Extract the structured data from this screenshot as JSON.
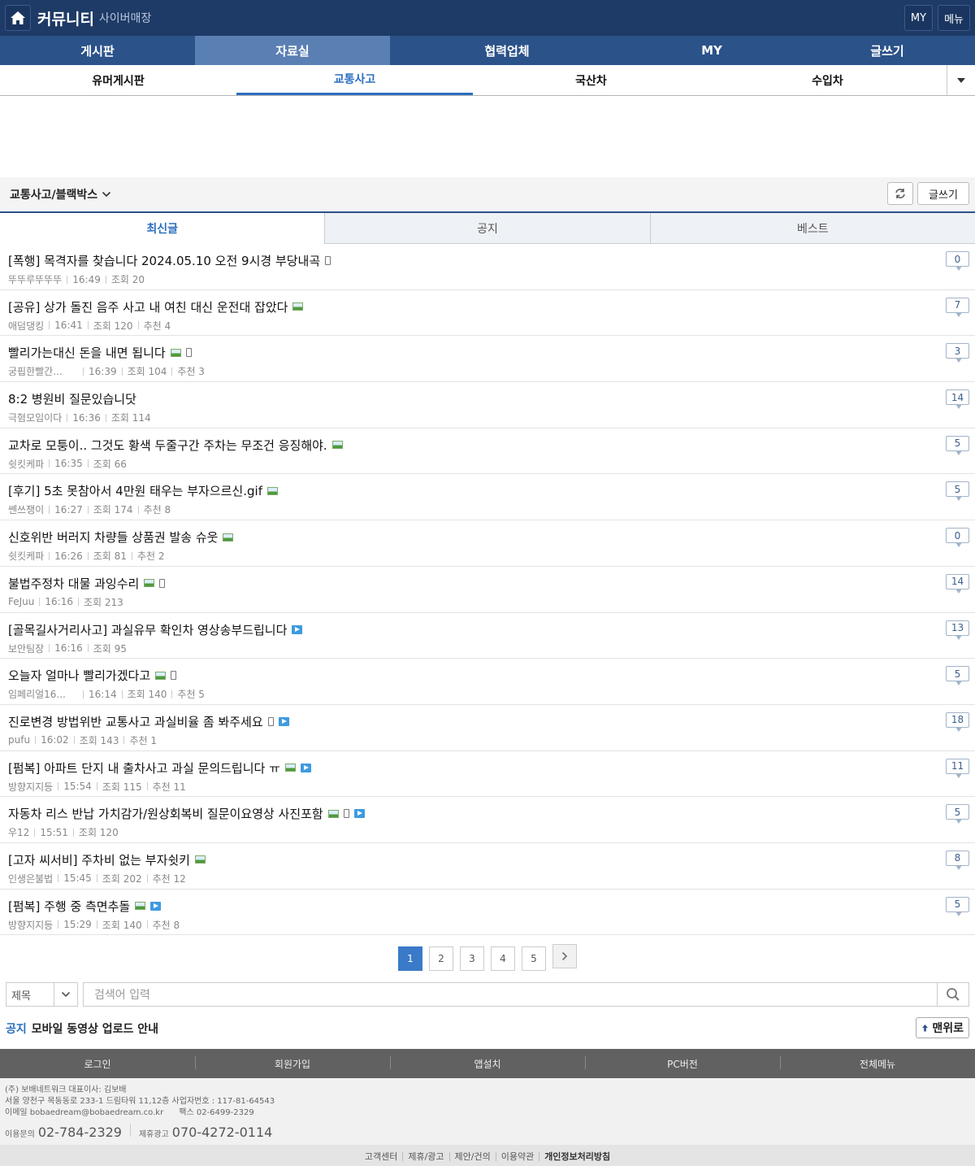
{
  "header": {
    "brand": "커뮤니티",
    "brand_sub": "사이버매장",
    "my_label": "MY",
    "menu_label": "메뉴"
  },
  "main_nav": [
    {
      "label": "게시판",
      "active": false
    },
    {
      "label": "자료실",
      "active": true
    },
    {
      "label": "협력업체",
      "active": false
    },
    {
      "label": "MY",
      "active": false
    },
    {
      "label": "글쓰기",
      "active": false
    }
  ],
  "sub_nav": [
    {
      "label": "유머게시판",
      "active": false
    },
    {
      "label": "교통사고",
      "active": true
    },
    {
      "label": "국산차",
      "active": false
    },
    {
      "label": "수입차",
      "active": false
    }
  ],
  "board": {
    "title": "교통사고/블랙박스",
    "write_label": "글쓰기"
  },
  "tabs": [
    {
      "label": "최신글",
      "active": true
    },
    {
      "label": "공지",
      "active": false
    },
    {
      "label": "베스트",
      "active": false
    }
  ],
  "posts": [
    {
      "title": "[폭행] 목격자를 찾습니다 2024.05.10 오전 9시경 부당내곡",
      "icons": [
        "mobile"
      ],
      "author": "뚜뚜루뚜뚜뚜",
      "time": "16:49",
      "views": "조회 20",
      "likes": "",
      "comments": "0"
    },
    {
      "title": "[공유] 상가 돌진 음주 사고 내 여친 대신 운전대 잡았다",
      "icons": [
        "image"
      ],
      "author": "애덤댕킹",
      "time": "16:41",
      "views": "조회 120",
      "likes": "추천 4",
      "comments": "7"
    },
    {
      "title": "빨리가는대신 돈을 내면 됩니다",
      "icons": [
        "image",
        "mobile"
      ],
      "author": "궁핍한빨간...",
      "time": "16:39",
      "views": "조회 104",
      "likes": "추천 3",
      "comments": "3"
    },
    {
      "title": "8:2 병원비 질문있습니닷",
      "icons": [],
      "author": "극혐모임이다",
      "time": "16:36",
      "views": "조회 114",
      "likes": "",
      "comments": "14"
    },
    {
      "title": "교차로 모퉁이.. 그것도 황색 두줄구간 주차는 무조건 응징해야.",
      "icons": [
        "image"
      ],
      "author": "쉿킷케파",
      "time": "16:35",
      "views": "조회 66",
      "likes": "",
      "comments": "5"
    },
    {
      "title": "[후기] 5초 못참아서 4만원 태우는 부자으르신.gif",
      "icons": [
        "image"
      ],
      "author": "쎈쓰쟁이",
      "time": "16:27",
      "views": "조회 174",
      "likes": "추천 8",
      "comments": "5"
    },
    {
      "title": "신호위반 버러지 차량들 상품권 발송 슈웃",
      "icons": [
        "image"
      ],
      "author": "쉿킷케파",
      "time": "16:26",
      "views": "조회 81",
      "likes": "추천 2",
      "comments": "0"
    },
    {
      "title": "불법주정차 대물 과잉수리",
      "icons": [
        "image",
        "mobile"
      ],
      "author": "FeJuu",
      "time": "16:16",
      "views": "조회 213",
      "likes": "",
      "comments": "14"
    },
    {
      "title": "[골목길사거리사고] 과실유무 확인차 영상송부드립니다",
      "icons": [
        "video"
      ],
      "author": "보안팀장",
      "time": "16:16",
      "views": "조회 95",
      "likes": "",
      "comments": "13"
    },
    {
      "title": "오늘자 얼마나 빨리가겠다고",
      "icons": [
        "image",
        "mobile"
      ],
      "author": "임페리얼16...",
      "time": "16:14",
      "views": "조회 140",
      "likes": "추천 5",
      "comments": "5"
    },
    {
      "title": "진로변경 방법위반 교통사고 과실비율 좀 봐주세요",
      "icons": [
        "mobile",
        "video"
      ],
      "author": "pufu",
      "time": "16:02",
      "views": "조회 143",
      "likes": "추천 1",
      "comments": "18"
    },
    {
      "title": "[펌복] 아파트 단지 내 출차사고 과실 문의드립니다 ㅠ",
      "icons": [
        "image",
        "video"
      ],
      "author": "방향지지등",
      "time": "15:54",
      "views": "조회 115",
      "likes": "추천 11",
      "comments": "11"
    },
    {
      "title": "자동차 리스 반납 가치감가/원상회복비 질문이요영상 사진포함",
      "icons": [
        "image",
        "mobile",
        "video"
      ],
      "author": "우12",
      "time": "15:51",
      "views": "조회 120",
      "likes": "",
      "comments": "5"
    },
    {
      "title": "[고자 씨서비] 주차비 없는 부자쉿키",
      "icons": [
        "image"
      ],
      "author": "인생은불법",
      "time": "15:45",
      "views": "조회 202",
      "likes": "추천 12",
      "comments": "8"
    },
    {
      "title": "[펌복] 주행 중 측면추돌",
      "icons": [
        "image",
        "video"
      ],
      "author": "방향지지등",
      "time": "15:29",
      "views": "조회 140",
      "likes": "추천 8",
      "comments": "5"
    }
  ],
  "pager": {
    "pages": [
      "1",
      "2",
      "3",
      "4",
      "5"
    ],
    "current": "1"
  },
  "search": {
    "field": "제목",
    "placeholder": "검색어 입력"
  },
  "notice": {
    "label": "공지",
    "text": "모바일 동영상 업로드 안내",
    "top_label": "맨위로"
  },
  "footer_nav": [
    "로그인",
    "회원가입",
    "앱설치",
    "PC버전",
    "전체메뉴"
  ],
  "footer_info": {
    "line1": "(주) 보배네트워크 대표이사: 김보배",
    "line2": "서울 양천구 목동동로 233-1 드림타워 11,12층 사업자번호 : 117-81-64543",
    "line3": "이메일 bobaedream@bobaedream.co.kr      팩스 02-6499-2329",
    "contact1_label": "이용문의",
    "contact1_value": "02-784-2329",
    "contact2_label": "제휴광고",
    "contact2_value": "070-4272-0114"
  },
  "footer_links": [
    {
      "label": "고객센터",
      "bold": false
    },
    {
      "label": "제휴/광고",
      "bold": false
    },
    {
      "label": "제안/건의",
      "bold": false
    },
    {
      "label": "이용약관",
      "bold": false
    },
    {
      "label": "개인정보처리방침",
      "bold": true
    }
  ],
  "colors": {
    "header_bg": "#1e3a66",
    "nav_bg": "#2b5289",
    "accent": "#2c6fbf"
  }
}
